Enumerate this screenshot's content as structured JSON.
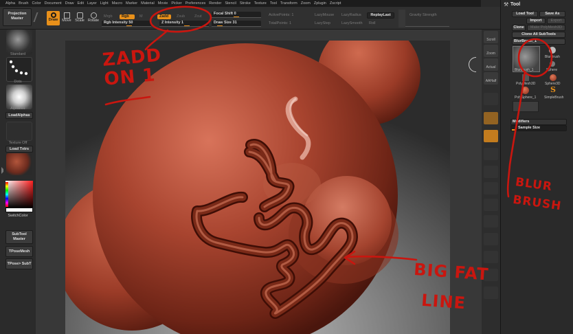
{
  "menu": [
    "Alpha",
    "Brush",
    "Color",
    "Document",
    "Draw",
    "Edit",
    "Layer",
    "Light",
    "Macro",
    "Marker",
    "Material",
    "Movie",
    "Picker",
    "Preferences",
    "Render",
    "Stencil",
    "Stroke",
    "Texture",
    "Tool",
    "Transform",
    "Zoom",
    "Zplugin",
    "Zscript"
  ],
  "shelf": {
    "projection_master": "Projection Master",
    "draw": "Draw",
    "move": "Move",
    "scale": "Scale",
    "rotate": "Rotate",
    "mrgb": "Mrgb",
    "rgb": "Rgb",
    "m": "M",
    "rgb_intensity": "Rgb Intensity 50",
    "zadd": "Zadd",
    "zsub": "Zsub",
    "zcut": "Zcut",
    "z_intensity": "Z Intensity 1",
    "focal_shift": "Focal Shift 0",
    "draw_size": "Draw Size 31",
    "active_points": "ActivePoints: 1",
    "total_points": "TotalPoints: 1",
    "lazy_mouse": "LazyMouse",
    "lazy_radius": "LazyRadius",
    "lazy_step": "LazyStep",
    "lazy_smooth": "LazySmooth",
    "replay_last": "ReplayLast",
    "roll": "Roll",
    "gravity_strength": "Gravity Strength"
  },
  "left_tray": {
    "standard": "Standard",
    "dots": "Dots",
    "alpha": "Alpha 01",
    "load_alphas": "LoadAlphas",
    "texture_off": "Texture Off",
    "load_txtrs": "Load Txtrs",
    "switch_color": "SwitchColor",
    "subtool_master": "SubTool Master",
    "tpose_mesh": "TPoseMesh",
    "tpose_subt": "TPose> SubT"
  },
  "right_shelf": [
    "Scroll",
    "Zoom",
    "Actual",
    "AAHalf",
    "",
    "",
    "",
    "",
    "",
    "",
    ""
  ],
  "tool_palette": {
    "title": "Tool",
    "load_tool": "Load Tool",
    "save_as": "Save As",
    "import": "Import",
    "export": "Export",
    "clone": "Clone",
    "make_polymesh": "Make PolyMesh3D",
    "clone_all": "Clone All SubTools",
    "blurbrush_current": "BlurBrush_1",
    "items": [
      "BlurBrush_1",
      "BlurBrush",
      "Sphere",
      "PolyMesh3D",
      "Sphere3D",
      "PolySphere_1",
      "SimpleBrush"
    ],
    "modifiers": "Modifiers",
    "sample_size": "Sample Size"
  },
  "annotations": {
    "zadd_line1": "ZADD",
    "zadd_line2": "ON 1",
    "blur_line1": "BLUR",
    "blur_line2": "BRUSH",
    "fat_line1": "BIG FAT",
    "fat_line2": "LINE"
  },
  "colors": {
    "accent": "#e8901a",
    "annotation": "#c9160f",
    "clay": "#a8442f"
  }
}
